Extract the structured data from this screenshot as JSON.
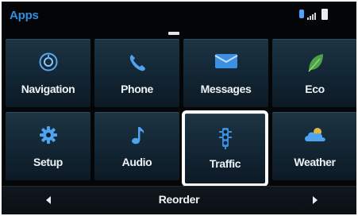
{
  "header": {
    "title": "Apps"
  },
  "status": {
    "bluetooth": "bluetooth-icon",
    "signal": "signal-icon",
    "battery": "battery-icon"
  },
  "apps": [
    {
      "label": "Navigation",
      "icon": "navigation-icon"
    },
    {
      "label": "Phone",
      "icon": "phone-icon"
    },
    {
      "label": "Messages",
      "icon": "messages-icon"
    },
    {
      "label": "Eco",
      "icon": "eco-leaf-icon"
    },
    {
      "label": "Setup",
      "icon": "gear-icon"
    },
    {
      "label": "Audio",
      "icon": "music-note-icon"
    },
    {
      "label": "Traffic",
      "icon": "traffic-light-icon",
      "selected": true
    },
    {
      "label": "Weather",
      "icon": "weather-cloud-icon"
    }
  ],
  "footer": {
    "reorder_label": "Reorder"
  },
  "colors": {
    "accent": "#2f8ee0",
    "tile": "#132736",
    "selection": "#ffffff"
  }
}
